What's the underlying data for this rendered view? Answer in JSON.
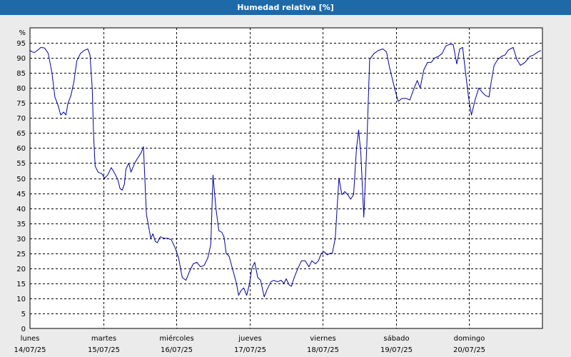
{
  "chart_data": {
    "type": "line",
    "title": "Humedad relativa [%]",
    "ylabel": "%",
    "ylim": [
      0,
      100
    ],
    "yticks": [
      0,
      5,
      10,
      15,
      20,
      25,
      30,
      35,
      40,
      45,
      50,
      55,
      60,
      65,
      70,
      75,
      80,
      85,
      90,
      95
    ],
    "xlim": [
      0,
      7
    ],
    "grid": true,
    "x_tick_labels": [
      {
        "day": "lunes",
        "date": "14/07/25"
      },
      {
        "day": "martes",
        "date": "15/07/25"
      },
      {
        "day": "miércoles",
        "date": "16/07/25"
      },
      {
        "day": "jueves",
        "date": "17/07/25"
      },
      {
        "day": "viernes",
        "date": "18/07/25"
      },
      {
        "day": "sábado",
        "date": "19/07/25"
      },
      {
        "day": "domingo",
        "date": "20/07/25"
      }
    ],
    "colors": {
      "line": "#0000a0",
      "grid": "#000000",
      "plot_bg": "#ffffff",
      "title_bg": "#1e6aa8"
    },
    "series": [
      {
        "points": [
          [
            0.0,
            92.5
          ],
          [
            0.03,
            92.0
          ],
          [
            0.06,
            91.8
          ],
          [
            0.1,
            92.5
          ],
          [
            0.15,
            93.5
          ],
          [
            0.2,
            93.3
          ],
          [
            0.25,
            91.5
          ],
          [
            0.3,
            85.0
          ],
          [
            0.34,
            77.0
          ],
          [
            0.38,
            74.5
          ],
          [
            0.42,
            71.0
          ],
          [
            0.46,
            72.0
          ],
          [
            0.49,
            71.0
          ],
          [
            0.52,
            75.0
          ],
          [
            0.56,
            77.5
          ],
          [
            0.6,
            82.0
          ],
          [
            0.64,
            89.0
          ],
          [
            0.69,
            91.5
          ],
          [
            0.74,
            92.5
          ],
          [
            0.79,
            93.0
          ],
          [
            0.82,
            91.0
          ],
          [
            0.85,
            80.0
          ],
          [
            0.87,
            64.0
          ],
          [
            0.89,
            54.0
          ],
          [
            0.93,
            52.0
          ],
          [
            0.98,
            51.5
          ],
          [
            1.02,
            50.0
          ],
          [
            1.06,
            51.0
          ],
          [
            1.11,
            53.5
          ],
          [
            1.16,
            51.5
          ],
          [
            1.2,
            49.5
          ],
          [
            1.23,
            46.5
          ],
          [
            1.26,
            46.0
          ],
          [
            1.29,
            48.0
          ],
          [
            1.31,
            53.0
          ],
          [
            1.35,
            55.0
          ],
          [
            1.38,
            52.0
          ],
          [
            1.43,
            55.0
          ],
          [
            1.48,
            57.0
          ],
          [
            1.52,
            58.5
          ],
          [
            1.55,
            60.5
          ],
          [
            1.59,
            38.0
          ],
          [
            1.62,
            34.0
          ],
          [
            1.65,
            30.0
          ],
          [
            1.68,
            31.5
          ],
          [
            1.71,
            29.0
          ],
          [
            1.74,
            28.5
          ],
          [
            1.78,
            30.5
          ],
          [
            1.83,
            30.0
          ],
          [
            1.88,
            30.0
          ],
          [
            1.93,
            29.5
          ],
          [
            1.98,
            27.0
          ],
          [
            2.03,
            23.5
          ],
          [
            2.08,
            17.0
          ],
          [
            2.13,
            16.0
          ],
          [
            2.18,
            19.0
          ],
          [
            2.23,
            21.5
          ],
          [
            2.28,
            22.0
          ],
          [
            2.33,
            20.5
          ],
          [
            2.38,
            21.0
          ],
          [
            2.43,
            23.5
          ],
          [
            2.47,
            28.0
          ],
          [
            2.5,
            51.0
          ],
          [
            2.54,
            40.0
          ],
          [
            2.58,
            32.5
          ],
          [
            2.62,
            32.0
          ],
          [
            2.65,
            30.5
          ],
          [
            2.68,
            25.0
          ],
          [
            2.72,
            24.0
          ],
          [
            2.77,
            19.5
          ],
          [
            2.82,
            15.0
          ],
          [
            2.85,
            11.0
          ],
          [
            2.88,
            12.5
          ],
          [
            2.92,
            13.5
          ],
          [
            2.96,
            11.0
          ],
          [
            3.0,
            15.0
          ],
          [
            3.03,
            20.0
          ],
          [
            3.07,
            22.0
          ],
          [
            3.11,
            17.0
          ],
          [
            3.15,
            16.0
          ],
          [
            3.2,
            10.5
          ],
          [
            3.24,
            13.0
          ],
          [
            3.29,
            15.5
          ],
          [
            3.33,
            16.0
          ],
          [
            3.38,
            15.5
          ],
          [
            3.43,
            16.0
          ],
          [
            3.47,
            15.0
          ],
          [
            3.5,
            16.5
          ],
          [
            3.54,
            14.5
          ],
          [
            3.57,
            14.0
          ],
          [
            3.61,
            17.0
          ],
          [
            3.66,
            20.0
          ],
          [
            3.71,
            22.5
          ],
          [
            3.76,
            22.5
          ],
          [
            3.81,
            20.5
          ],
          [
            3.85,
            22.5
          ],
          [
            3.9,
            21.5
          ],
          [
            3.94,
            22.5
          ],
          [
            3.98,
            25.0
          ],
          [
            4.02,
            25.5
          ],
          [
            4.06,
            24.5
          ],
          [
            4.1,
            25.0
          ],
          [
            4.13,
            25.0
          ],
          [
            4.17,
            30.0
          ],
          [
            4.22,
            50.0
          ],
          [
            4.26,
            44.5
          ],
          [
            4.3,
            45.5
          ],
          [
            4.34,
            44.5
          ],
          [
            4.38,
            43.0
          ],
          [
            4.42,
            44.5
          ],
          [
            4.46,
            60.0
          ],
          [
            4.49,
            66.0
          ],
          [
            4.52,
            58.0
          ],
          [
            4.56,
            37.0
          ],
          [
            4.6,
            60.0
          ],
          [
            4.64,
            89.5
          ],
          [
            4.7,
            91.5
          ],
          [
            4.76,
            92.5
          ],
          [
            4.82,
            93.0
          ],
          [
            4.87,
            92.0
          ],
          [
            4.91,
            87.0
          ],
          [
            4.95,
            83.0
          ],
          [
            4.99,
            79.0
          ],
          [
            5.03,
            75.5
          ],
          [
            5.08,
            76.5
          ],
          [
            5.14,
            76.5
          ],
          [
            5.19,
            76.0
          ],
          [
            5.24,
            79.5
          ],
          [
            5.29,
            82.5
          ],
          [
            5.33,
            80.0
          ],
          [
            5.38,
            86.0
          ],
          [
            5.43,
            88.5
          ],
          [
            5.48,
            88.5
          ],
          [
            5.53,
            90.0
          ],
          [
            5.58,
            90.5
          ],
          [
            5.63,
            91.5
          ],
          [
            5.68,
            94.0
          ],
          [
            5.73,
            94.5
          ],
          [
            5.78,
            94.5
          ],
          [
            5.83,
            88.0
          ],
          [
            5.87,
            93.0
          ],
          [
            5.91,
            93.5
          ],
          [
            5.95,
            85.0
          ],
          [
            5.99,
            77.0
          ],
          [
            6.03,
            71.0
          ],
          [
            6.08,
            76.0
          ],
          [
            6.13,
            80.0
          ],
          [
            6.18,
            78.5
          ],
          [
            6.22,
            77.5
          ],
          [
            6.27,
            77.0
          ],
          [
            6.3,
            82.0
          ],
          [
            6.34,
            87.5
          ],
          [
            6.39,
            89.5
          ],
          [
            6.44,
            90.5
          ],
          [
            6.49,
            91.0
          ],
          [
            6.53,
            92.5
          ],
          [
            6.56,
            93.0
          ],
          [
            6.6,
            93.5
          ],
          [
            6.65,
            89.5
          ],
          [
            6.7,
            87.5
          ],
          [
            6.76,
            88.5
          ],
          [
            6.83,
            90.5
          ],
          [
            6.88,
            91.0
          ],
          [
            6.94,
            92.0
          ],
          [
            6.98,
            92.5
          ]
        ]
      }
    ]
  }
}
